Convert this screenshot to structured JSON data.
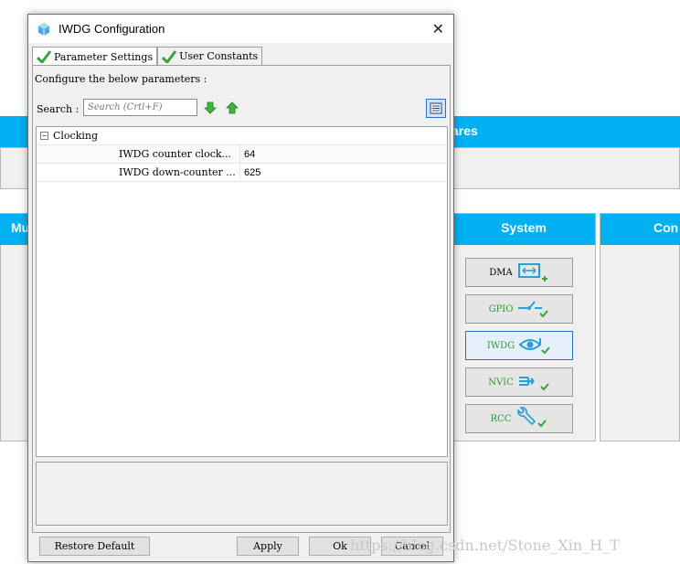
{
  "background": {
    "middleware_label": "ares",
    "multimedia_label": "Mu",
    "system_label": "System",
    "control_label": "Con",
    "system_buttons": [
      {
        "label": "DMA",
        "icon": "dma-icon"
      },
      {
        "label": "GPIO",
        "icon": "gpio-icon"
      },
      {
        "label": "IWDG",
        "icon": "eye-icon"
      },
      {
        "label": "NVIC",
        "icon": "nvic-icon"
      },
      {
        "label": "RCC",
        "icon": "wrench-icon"
      }
    ]
  },
  "dialog": {
    "title": "IWDG Configuration",
    "tabs": [
      {
        "label": "Parameter Settings"
      },
      {
        "label": "User Constants"
      }
    ],
    "configure_label": "Configure the below parameters :",
    "search_label": "Search :",
    "search_placeholder": "Search (Crtl+F)",
    "tree": {
      "group": "Clocking",
      "rows": [
        {
          "name": "IWDG counter clock...",
          "value": "64"
        },
        {
          "name": "IWDG down-counter ...",
          "value": "625"
        }
      ]
    },
    "buttons": {
      "restore": "Restore Default",
      "apply": "Apply",
      "ok": "Ok",
      "cancel": "Cancel"
    }
  },
  "watermark": "https://blog.csdn.net/Stone_Xin_H_T",
  "colors": {
    "accent": "#00b0f0",
    "check": "#3aa33a"
  }
}
